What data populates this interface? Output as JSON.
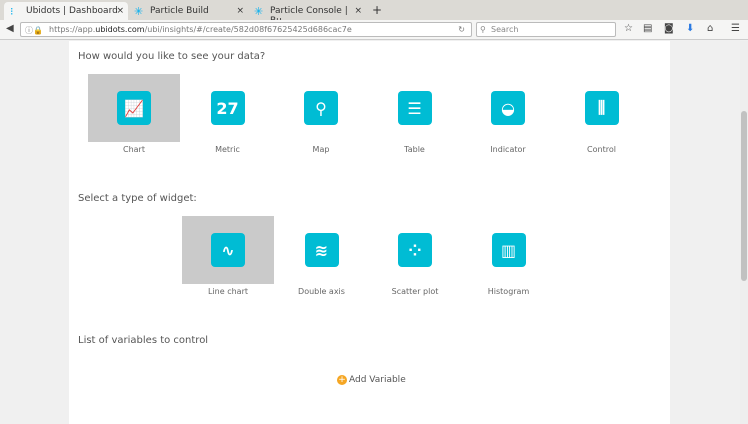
{
  "browser": {
    "tabs": [
      {
        "title": "Ubidots | Dashboard"
      },
      {
        "title": "Particle Build"
      },
      {
        "title": "Particle Console | Bu..."
      }
    ],
    "url_prefix": "https://app.",
    "url_domain": "ubidots.com",
    "url_path": "/ubi/insights/#/create/582d08f67625425d686cac7e",
    "search_placeholder": "Search"
  },
  "section1": {
    "title": "How would you like to see your data?",
    "options": [
      {
        "label": "Chart",
        "glyph": "📈"
      },
      {
        "label": "Metric",
        "glyph": "27"
      },
      {
        "label": "Map",
        "glyph": "⚲"
      },
      {
        "label": "Table",
        "glyph": "☰"
      },
      {
        "label": "Indicator",
        "glyph": "◒"
      },
      {
        "label": "Control",
        "glyph": "⫼"
      }
    ]
  },
  "section2": {
    "title": "Select a type of widget:",
    "options": [
      {
        "label": "Line chart",
        "glyph": "∿"
      },
      {
        "label": "Double axis",
        "glyph": "≋"
      },
      {
        "label": "Scatter plot",
        "glyph": "⁘"
      },
      {
        "label": "Histogram",
        "glyph": "▥"
      }
    ]
  },
  "section3": {
    "title": "List of variables to control",
    "add_label": "Add Variable"
  }
}
